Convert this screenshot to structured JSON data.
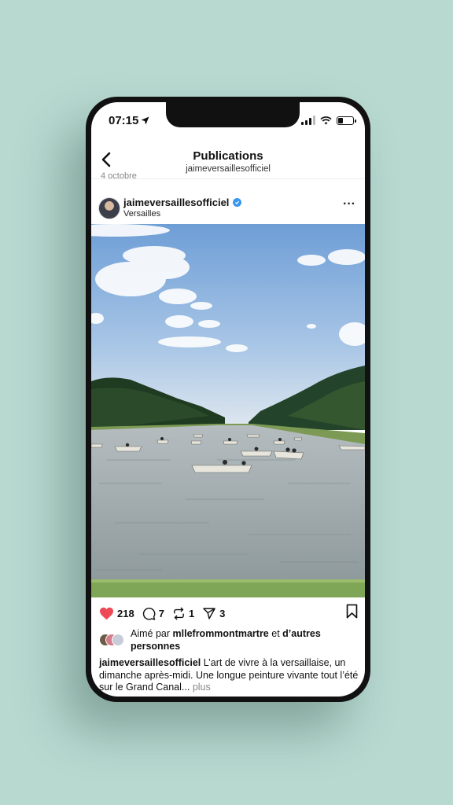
{
  "status": {
    "time": "07:15"
  },
  "header": {
    "title": "Publications",
    "subtitle": "jaimeversaillesofficiel"
  },
  "prev_date": "4 octobre",
  "post": {
    "username": "jaimeversaillesofficiel",
    "location": "Versailles",
    "likes_count": "218",
    "comments_count": "7",
    "reposts_count": "1",
    "shares_count": "3",
    "liked_by_prefix": "Aimé par",
    "liked_by_user": "mllefrommontmartre",
    "liked_by_and": "et",
    "liked_by_others": "d’autres personnes",
    "caption_user": "jaimeversaillesofficiel",
    "caption_text": "L’art de vivre à la versaillaise, un dimanche après-midi. Une longue peinture vivante tout l’été sur le Grand Canal...",
    "more_label": "plus"
  },
  "colors": {
    "background": "#b7d9d0",
    "like": "#ed4956",
    "verified": "#3897f0"
  },
  "icons": [
    "back-chevron-icon",
    "location-arrow-icon",
    "signal-icon",
    "wifi-icon",
    "battery-icon",
    "verified-icon",
    "more-options-icon",
    "heart-icon",
    "comment-icon",
    "repost-icon",
    "share-icon",
    "bookmark-icon"
  ]
}
